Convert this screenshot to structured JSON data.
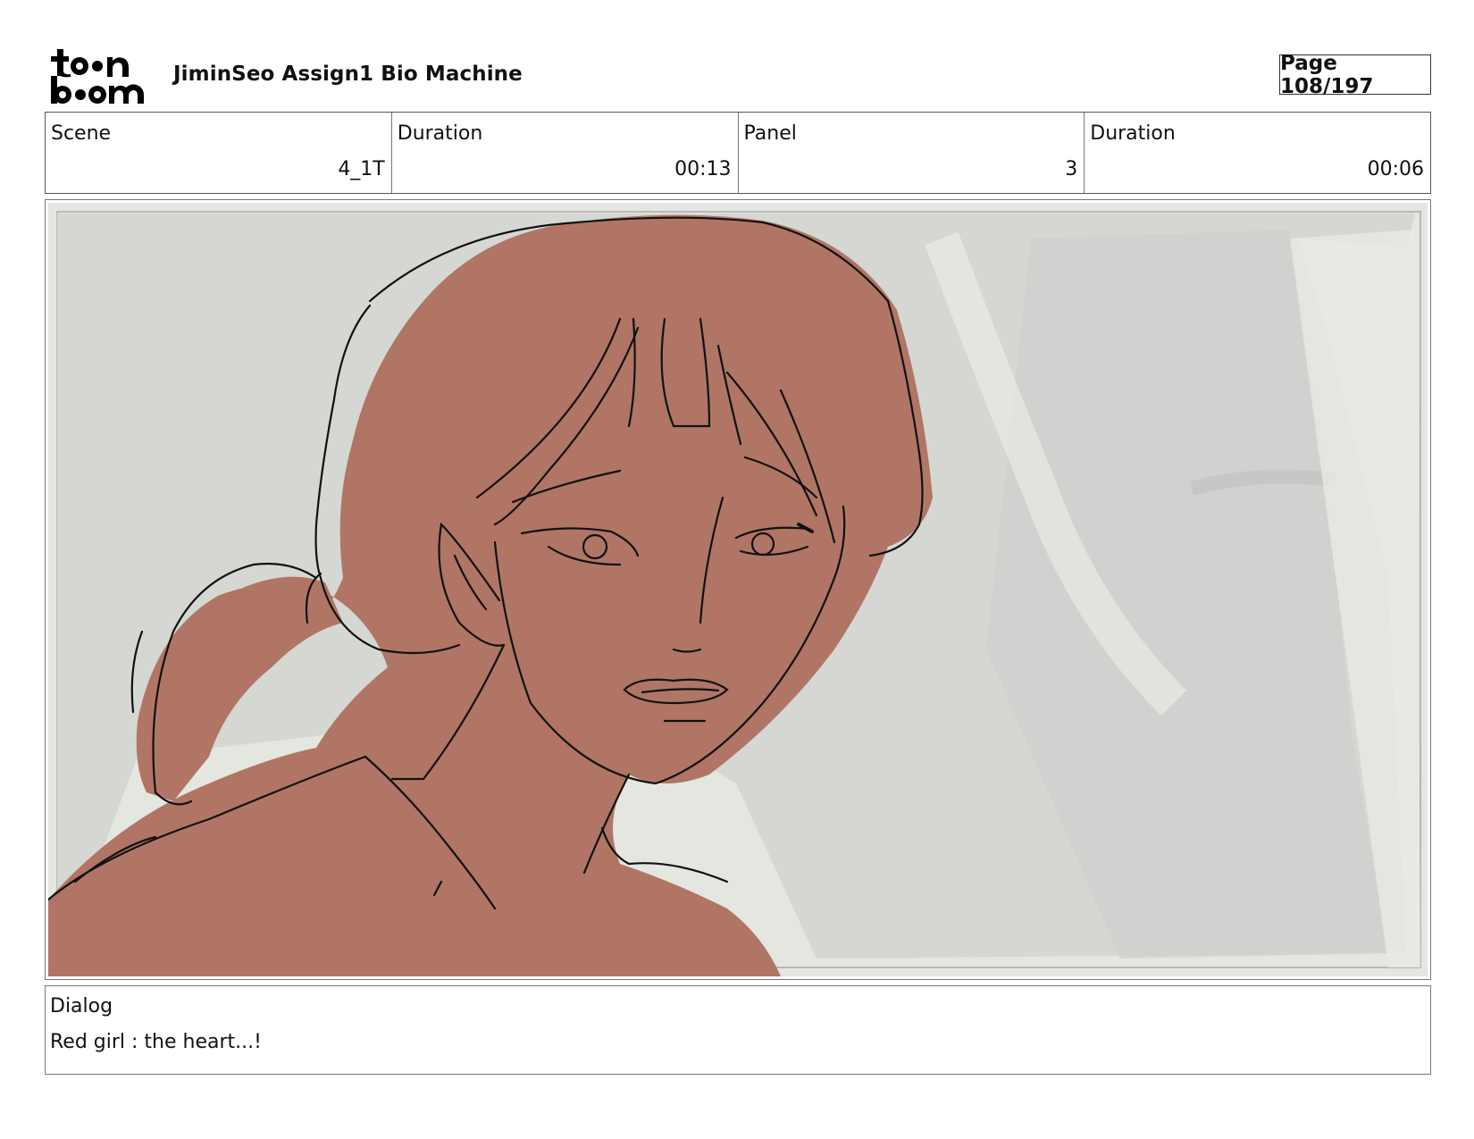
{
  "header": {
    "logo_text": "toon boom",
    "project_title": "JiminSeo Assign1 Bio Machine",
    "page_label": "Page 108/197"
  },
  "info": {
    "scene_label": "Scene",
    "scene_value": "4_1T",
    "scene_duration_label": "Duration",
    "scene_duration_value": "00:13",
    "panel_label": "Panel",
    "panel_value": "3",
    "panel_duration_label": "Duration",
    "panel_duration_value": "00:06"
  },
  "colors": {
    "skin": "#b07565",
    "background_gray": "#d5d6d2",
    "background_light": "#e3e5df",
    "line": "#111111"
  },
  "dialog": {
    "label": "Dialog",
    "text": "Red girl : the heart...!"
  }
}
